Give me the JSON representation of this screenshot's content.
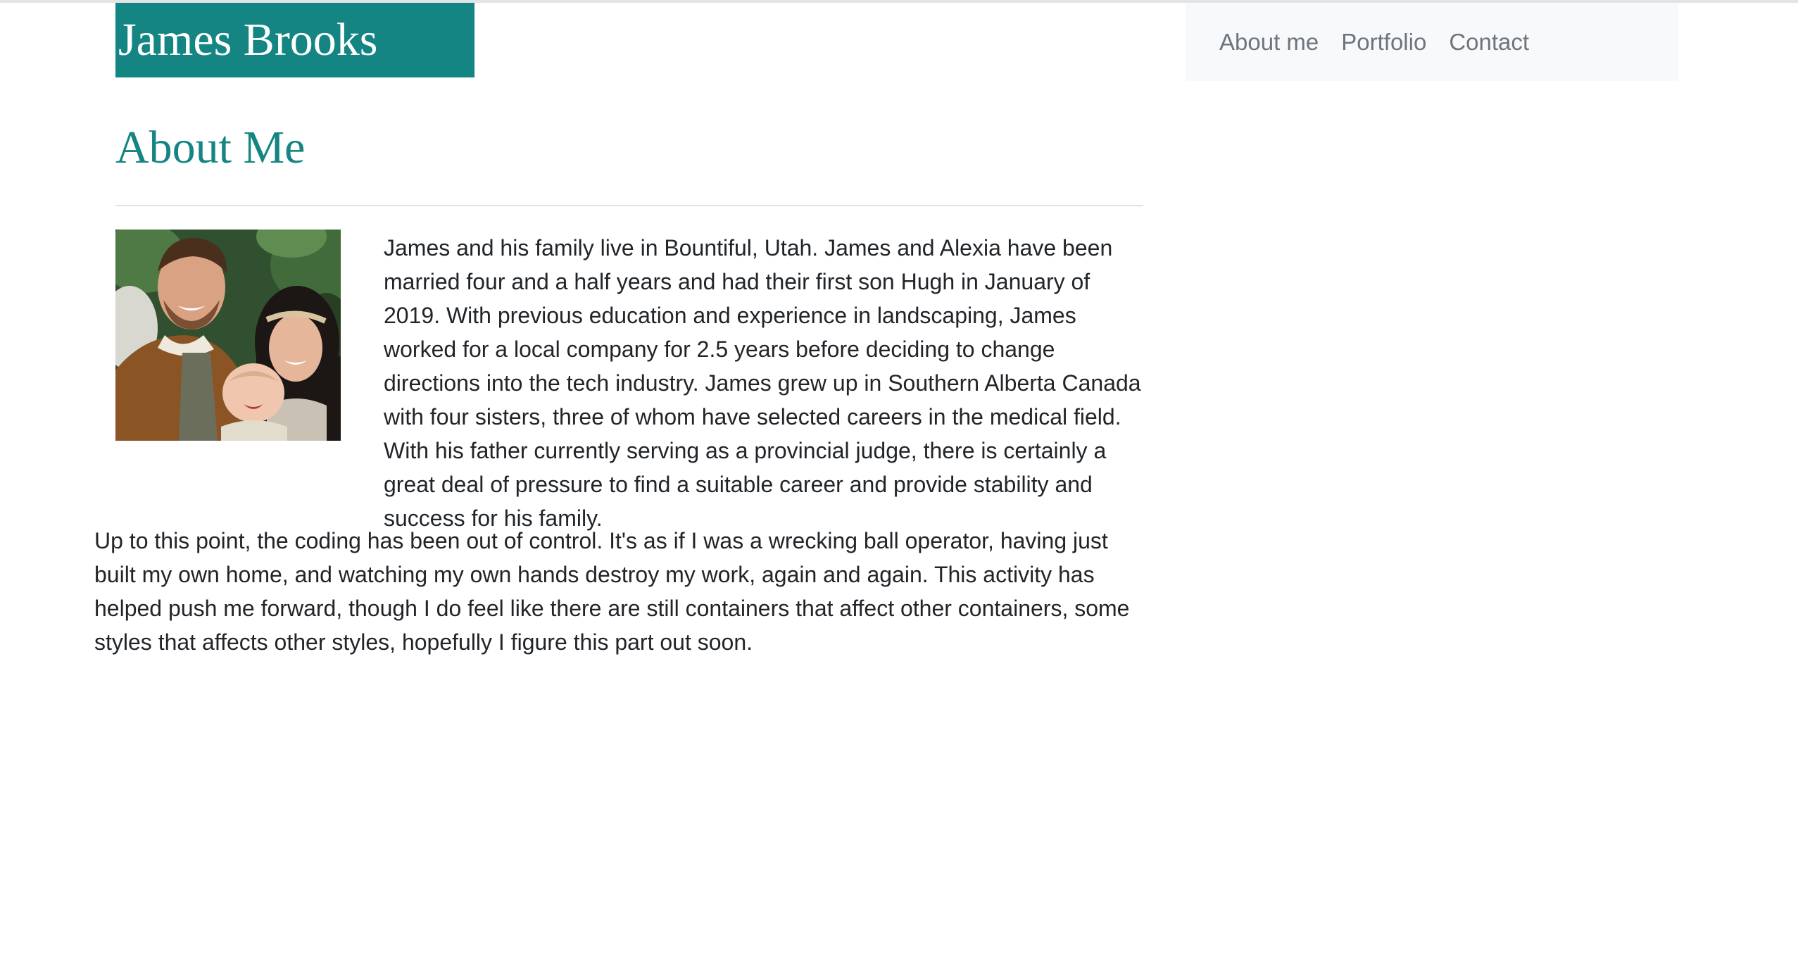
{
  "header": {
    "brand_name": "James Brooks",
    "brand_color": "#148582"
  },
  "nav": {
    "items": [
      {
        "label": "About me"
      },
      {
        "label": "Portfolio"
      },
      {
        "label": "Contact"
      }
    ]
  },
  "main": {
    "heading": "About Me",
    "photo_description": "family photo",
    "paragraph_1": "James and his family live in Bountiful, Utah. James and Alexia have been married four and a half years and had their first son Hugh in January of 2019. With previous education and experience in landscaping, James worked for a local company for 2.5 years before deciding to change directions into the tech industry. James grew up in Southern Alberta Canada with four sisters, three of whom have selected careers in the medical field. With his father currently serving as a provincial judge, there is certainly a great deal of pressure to find a suitable career and provide stability and success for his family.",
    "paragraph_2": "Up to this point, the coding has been out of control. It's as if I was a wrecking ball operator, having just built my own home, and watching my own hands destroy my work, again and again. This activity has helped push me forward, though I do feel like there are still containers that affect other containers, some styles that affects other styles, hopefully I figure this part out soon."
  }
}
